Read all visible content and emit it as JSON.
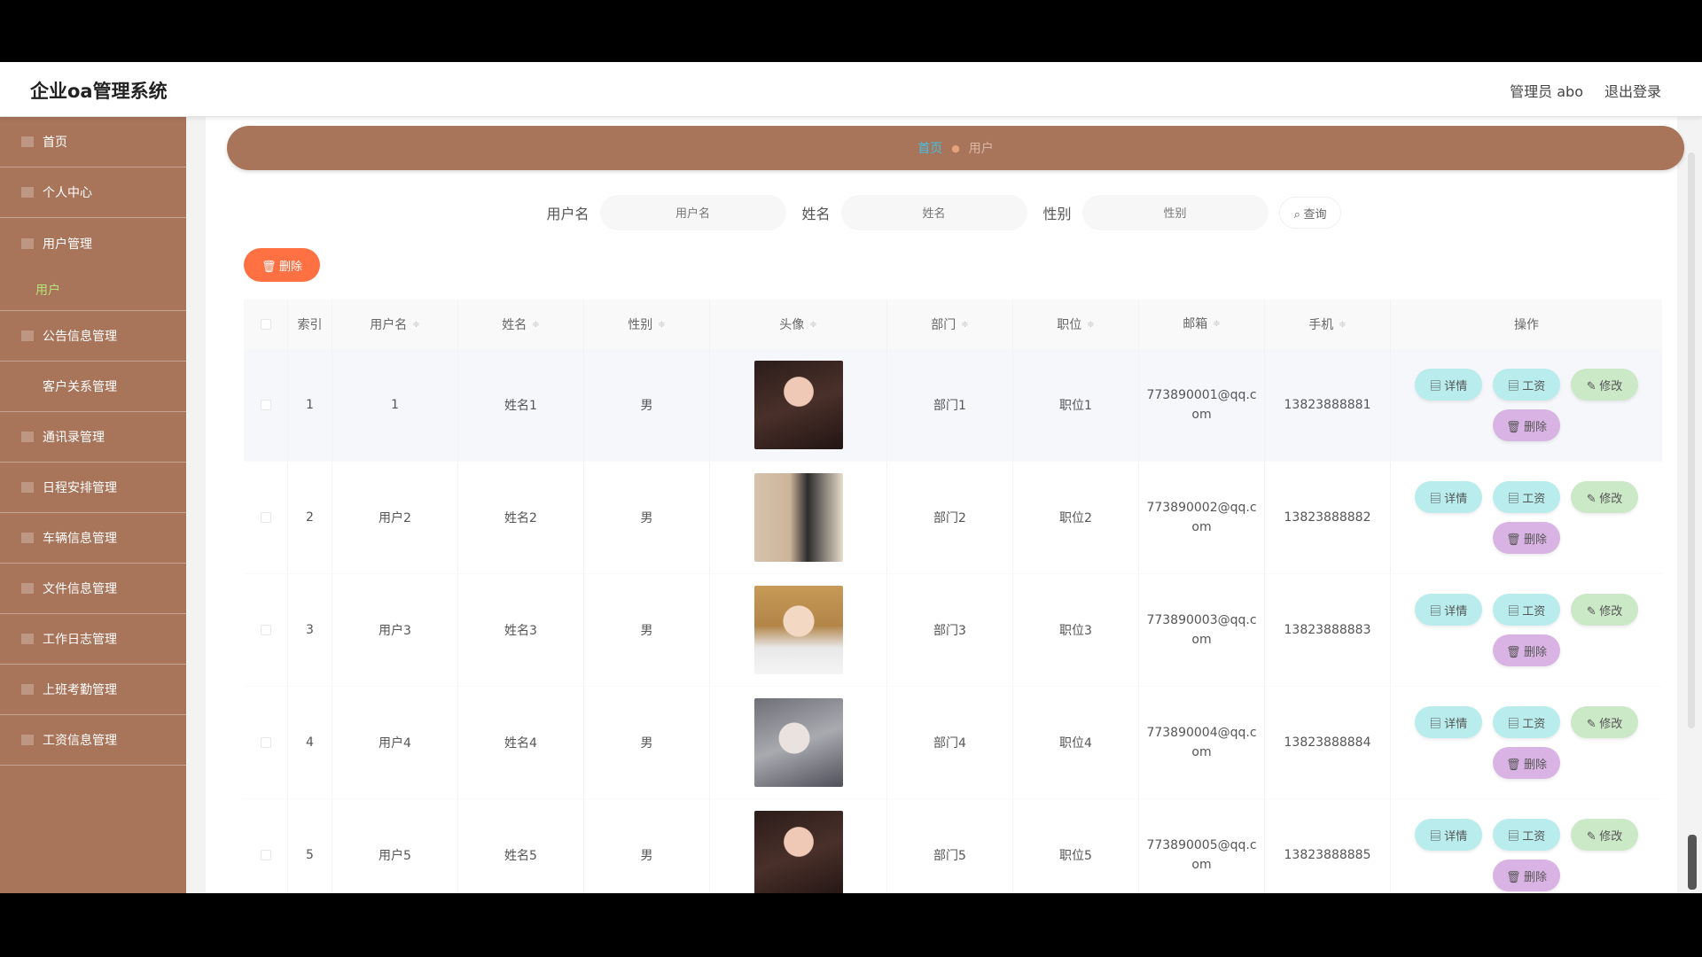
{
  "header": {
    "title": "企业oa管理系统",
    "user_label": "管理员 abo",
    "logout_label": "退出登录"
  },
  "sidebar": {
    "items": [
      {
        "label": "首页"
      },
      {
        "label": "个人中心"
      },
      {
        "label": "用户管理"
      },
      {
        "label": "用户",
        "sub": true
      },
      {
        "label": "公告信息管理"
      },
      {
        "label": "客户关系管理"
      },
      {
        "label": "通讯录管理"
      },
      {
        "label": "日程安排管理"
      },
      {
        "label": "车辆信息管理"
      },
      {
        "label": "文件信息管理"
      },
      {
        "label": "工作日志管理"
      },
      {
        "label": "上班考勤管理"
      },
      {
        "label": "工资信息管理"
      }
    ]
  },
  "breadcrumb": {
    "home": "首页",
    "current": "用户",
    "separator": "●"
  },
  "search": {
    "username_label": "用户名",
    "username_placeholder": "用户名",
    "name_label": "姓名",
    "name_placeholder": "姓名",
    "gender_label": "性别",
    "gender_placeholder": "性别",
    "search_button": "⌕ 查询"
  },
  "toolbar": {
    "delete_label": "🗑 删除"
  },
  "table": {
    "headers": {
      "index": "索引",
      "username": "用户名",
      "name": "姓名",
      "gender": "性别",
      "avatar": "头像",
      "department": "部门",
      "position": "职位",
      "email": "邮箱",
      "phone": "手机",
      "ops": "操作"
    },
    "sort_icon": "≑",
    "rows": [
      {
        "index": "1",
        "username": "1",
        "name": "姓名1",
        "gender": "男",
        "department": "部门1",
        "position": "职位1",
        "email": "773890001@qq.com",
        "phone": "13823888881"
      },
      {
        "index": "2",
        "username": "用户2",
        "name": "姓名2",
        "gender": "男",
        "department": "部门2",
        "position": "职位2",
        "email": "773890002@qq.com",
        "phone": "13823888882"
      },
      {
        "index": "3",
        "username": "用户3",
        "name": "姓名3",
        "gender": "男",
        "department": "部门3",
        "position": "职位3",
        "email": "773890003@qq.com",
        "phone": "13823888883"
      },
      {
        "index": "4",
        "username": "用户4",
        "name": "姓名4",
        "gender": "男",
        "department": "部门4",
        "position": "职位4",
        "email": "773890004@qq.com",
        "phone": "13823888884"
      },
      {
        "index": "5",
        "username": "用户5",
        "name": "姓名5",
        "gender": "男",
        "department": "部门5",
        "position": "职位5",
        "email": "773890005@qq.com",
        "phone": "13823888885"
      }
    ],
    "ops": {
      "detail": "▤ 详情",
      "salary": "▤ 工资",
      "edit": "✎ 修改",
      "delete": "🗑 删除"
    }
  },
  "colors": {
    "sidebar": "#a8745a",
    "accent_delete": "#ff7043",
    "breadcrumb_home": "#3fc3e6"
  },
  "icons": {
    "search": "search-icon",
    "delete": "trash-icon",
    "detail": "doc-icon",
    "salary": "doc-icon",
    "edit": "pencil-icon"
  }
}
